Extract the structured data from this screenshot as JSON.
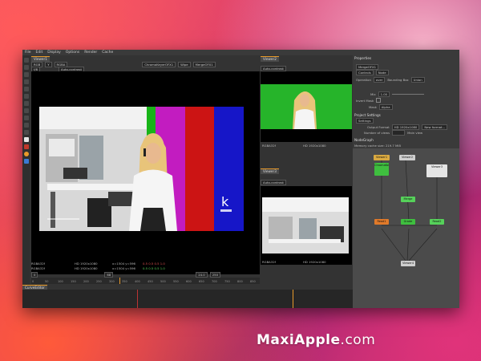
{
  "menubar": [
    "File",
    "Edit",
    "Display",
    "Options",
    "Render",
    "Cache"
  ],
  "main_viewer": {
    "tab": "Viewer1",
    "selectors": {
      "a": "RGB",
      "b": "Y",
      "c": "Y",
      "d": "RGBA",
      "gain": "f/8",
      "ch": "ChromaKeyerOFX1",
      "wipe": "Wipe",
      "merge": "MergeOFX1"
    },
    "auto_contrast": "Auto-contrast",
    "info_top": "RGBA32f",
    "info_bottom": "RGBA32f",
    "res_top": "HD 1920x1080",
    "res_bottom": "HD 1920x1080",
    "coords_top": "x=1504 y=596",
    "coords_bottom": "x=1504 y=596",
    "pixel_values_top": "0.5 0.5 0.5 1.0",
    "pixel_values_bottom": "0.5 0.5 0.5 1.0",
    "playback_fps": "24.0",
    "frame_current": "68",
    "frame_range": [
      "0",
      "250"
    ],
    "ruler": [
      "0",
      "50",
      "100",
      "150",
      "200",
      "250",
      "300",
      "350",
      "400",
      "450",
      "500",
      "550",
      "600",
      "650",
      "700",
      "750",
      "800",
      "850"
    ]
  },
  "viewer2": {
    "tab": "Viewer2",
    "auto_contrast": "Auto-contrast",
    "info": "RGBA32f",
    "res": "HD 1920x1080"
  },
  "viewer3": {
    "tab": "Viewer3",
    "auto_contrast": "Auto-contrast",
    "info": "RGBA32f",
    "res": "HD 1920x1080"
  },
  "curve_editor": {
    "tab": "CurveEditor"
  },
  "properties": {
    "title": "Properties",
    "node_name": "MergeOFX1",
    "tabs": [
      "Controls",
      "Node"
    ],
    "operation_label": "Operation",
    "operation_value": "over",
    "bbox_label": "Bounding Box",
    "bbox_value": "Union",
    "mix_label": "Mix",
    "mix_value": "1.00",
    "invert_mask_label": "Invert Mask",
    "mask_label": "Mask",
    "mask_value": "Alpha"
  },
  "project_settings": {
    "title": "Project Settings",
    "settings_tab": "Settings",
    "output_format_label": "Output Format",
    "output_format_value": "HD 1920x1080",
    "new_format": "New format...",
    "frame_range_label": "Number of views",
    "main_view_label": "Main view"
  },
  "nodegraph": {
    "title": "NodeGraph",
    "memory": "Memory cache size: 219.7 MiB",
    "nodes": [
      {
        "label": "Viewer1",
        "color": "#d9a941"
      },
      {
        "label": "Viewer2",
        "color": "#cfcfcf"
      },
      {
        "label": "Viewer3",
        "color": "#cfcfcf"
      },
      {
        "label": "ChromaKey",
        "color": "#3fbf3f"
      },
      {
        "label": "Merge",
        "color": "#56d15a"
      },
      {
        "label": "Read1",
        "color": "#e07a2a"
      },
      {
        "label": "Read2",
        "color": "#e07a2a"
      },
      {
        "label": "Grade",
        "color": "#56d15a"
      },
      {
        "label": "Viewer4",
        "color": "#cfcfcf"
      }
    ]
  },
  "colors": {
    "accent": "#e89a2a",
    "panel": "#333333",
    "viewer_bg": "#000000"
  },
  "watermark": {
    "brand_bold": "MaxiApple",
    "brand_light": ".com"
  }
}
